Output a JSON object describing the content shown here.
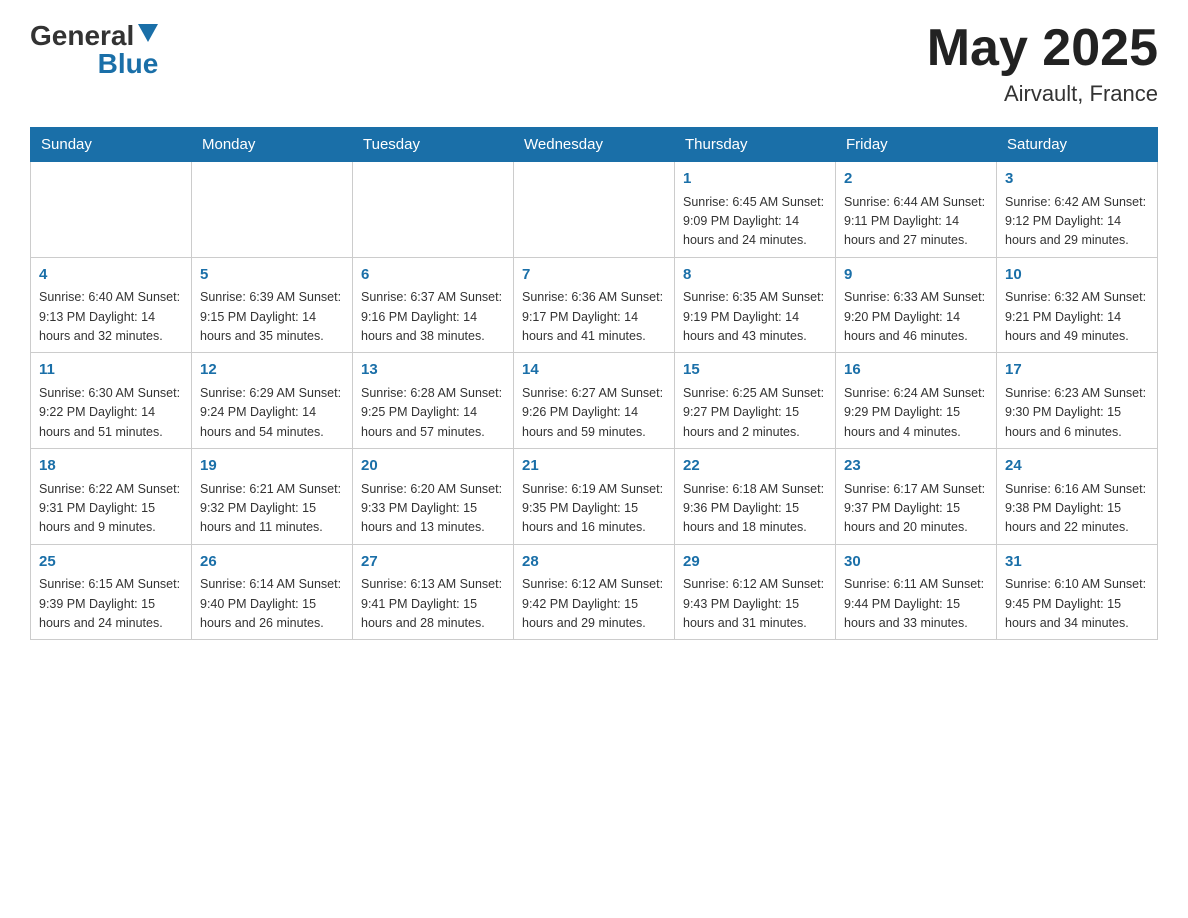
{
  "header": {
    "logo_general": "General",
    "logo_blue": "Blue",
    "month_title": "May 2025",
    "location": "Airvault, France"
  },
  "weekdays": [
    "Sunday",
    "Monday",
    "Tuesday",
    "Wednesday",
    "Thursday",
    "Friday",
    "Saturday"
  ],
  "weeks": [
    [
      {
        "day": "",
        "info": ""
      },
      {
        "day": "",
        "info": ""
      },
      {
        "day": "",
        "info": ""
      },
      {
        "day": "",
        "info": ""
      },
      {
        "day": "1",
        "info": "Sunrise: 6:45 AM\nSunset: 9:09 PM\nDaylight: 14 hours and 24 minutes."
      },
      {
        "day": "2",
        "info": "Sunrise: 6:44 AM\nSunset: 9:11 PM\nDaylight: 14 hours and 27 minutes."
      },
      {
        "day": "3",
        "info": "Sunrise: 6:42 AM\nSunset: 9:12 PM\nDaylight: 14 hours and 29 minutes."
      }
    ],
    [
      {
        "day": "4",
        "info": "Sunrise: 6:40 AM\nSunset: 9:13 PM\nDaylight: 14 hours and 32 minutes."
      },
      {
        "day": "5",
        "info": "Sunrise: 6:39 AM\nSunset: 9:15 PM\nDaylight: 14 hours and 35 minutes."
      },
      {
        "day": "6",
        "info": "Sunrise: 6:37 AM\nSunset: 9:16 PM\nDaylight: 14 hours and 38 minutes."
      },
      {
        "day": "7",
        "info": "Sunrise: 6:36 AM\nSunset: 9:17 PM\nDaylight: 14 hours and 41 minutes."
      },
      {
        "day": "8",
        "info": "Sunrise: 6:35 AM\nSunset: 9:19 PM\nDaylight: 14 hours and 43 minutes."
      },
      {
        "day": "9",
        "info": "Sunrise: 6:33 AM\nSunset: 9:20 PM\nDaylight: 14 hours and 46 minutes."
      },
      {
        "day": "10",
        "info": "Sunrise: 6:32 AM\nSunset: 9:21 PM\nDaylight: 14 hours and 49 minutes."
      }
    ],
    [
      {
        "day": "11",
        "info": "Sunrise: 6:30 AM\nSunset: 9:22 PM\nDaylight: 14 hours and 51 minutes."
      },
      {
        "day": "12",
        "info": "Sunrise: 6:29 AM\nSunset: 9:24 PM\nDaylight: 14 hours and 54 minutes."
      },
      {
        "day": "13",
        "info": "Sunrise: 6:28 AM\nSunset: 9:25 PM\nDaylight: 14 hours and 57 minutes."
      },
      {
        "day": "14",
        "info": "Sunrise: 6:27 AM\nSunset: 9:26 PM\nDaylight: 14 hours and 59 minutes."
      },
      {
        "day": "15",
        "info": "Sunrise: 6:25 AM\nSunset: 9:27 PM\nDaylight: 15 hours and 2 minutes."
      },
      {
        "day": "16",
        "info": "Sunrise: 6:24 AM\nSunset: 9:29 PM\nDaylight: 15 hours and 4 minutes."
      },
      {
        "day": "17",
        "info": "Sunrise: 6:23 AM\nSunset: 9:30 PM\nDaylight: 15 hours and 6 minutes."
      }
    ],
    [
      {
        "day": "18",
        "info": "Sunrise: 6:22 AM\nSunset: 9:31 PM\nDaylight: 15 hours and 9 minutes."
      },
      {
        "day": "19",
        "info": "Sunrise: 6:21 AM\nSunset: 9:32 PM\nDaylight: 15 hours and 11 minutes."
      },
      {
        "day": "20",
        "info": "Sunrise: 6:20 AM\nSunset: 9:33 PM\nDaylight: 15 hours and 13 minutes."
      },
      {
        "day": "21",
        "info": "Sunrise: 6:19 AM\nSunset: 9:35 PM\nDaylight: 15 hours and 16 minutes."
      },
      {
        "day": "22",
        "info": "Sunrise: 6:18 AM\nSunset: 9:36 PM\nDaylight: 15 hours and 18 minutes."
      },
      {
        "day": "23",
        "info": "Sunrise: 6:17 AM\nSunset: 9:37 PM\nDaylight: 15 hours and 20 minutes."
      },
      {
        "day": "24",
        "info": "Sunrise: 6:16 AM\nSunset: 9:38 PM\nDaylight: 15 hours and 22 minutes."
      }
    ],
    [
      {
        "day": "25",
        "info": "Sunrise: 6:15 AM\nSunset: 9:39 PM\nDaylight: 15 hours and 24 minutes."
      },
      {
        "day": "26",
        "info": "Sunrise: 6:14 AM\nSunset: 9:40 PM\nDaylight: 15 hours and 26 minutes."
      },
      {
        "day": "27",
        "info": "Sunrise: 6:13 AM\nSunset: 9:41 PM\nDaylight: 15 hours and 28 minutes."
      },
      {
        "day": "28",
        "info": "Sunrise: 6:12 AM\nSunset: 9:42 PM\nDaylight: 15 hours and 29 minutes."
      },
      {
        "day": "29",
        "info": "Sunrise: 6:12 AM\nSunset: 9:43 PM\nDaylight: 15 hours and 31 minutes."
      },
      {
        "day": "30",
        "info": "Sunrise: 6:11 AM\nSunset: 9:44 PM\nDaylight: 15 hours and 33 minutes."
      },
      {
        "day": "31",
        "info": "Sunrise: 6:10 AM\nSunset: 9:45 PM\nDaylight: 15 hours and 34 minutes."
      }
    ]
  ]
}
